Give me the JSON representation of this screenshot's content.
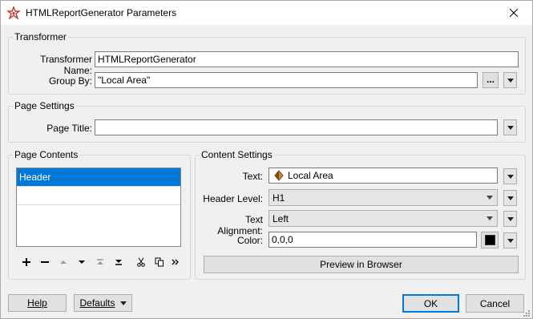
{
  "window": {
    "title": "HTMLReportGenerator Parameters"
  },
  "transformer": {
    "legend": "Transformer",
    "name_label": "Transformer Name:",
    "name_value": "HTMLReportGenerator",
    "group_label": "Group By:",
    "group_value": "\"Local Area\"",
    "ellipsis": "..."
  },
  "page_settings": {
    "legend": "Page Settings",
    "title_label": "Page Title:",
    "title_value": ""
  },
  "page_contents": {
    "legend": "Page Contents",
    "items": [
      "Header"
    ],
    "selected_index": 0,
    "toolbar_icons": [
      "add-icon",
      "remove-icon",
      "move-up-icon",
      "move-down-icon",
      "move-top-icon",
      "move-bottom-icon",
      "cut-icon",
      "copy-icon",
      "more-icon"
    ]
  },
  "content_settings": {
    "legend": "Content Settings",
    "text_label": "Text:",
    "text_value": "Local Area",
    "header_level_label": "Header Level:",
    "header_level_value": "H1",
    "alignment_label": "Text Alignment:",
    "alignment_value": "Left",
    "color_label": "Color:",
    "color_value": "0,0,0",
    "color_swatch": "#000000",
    "preview_label": "Preview in Browser"
  },
  "footer": {
    "help_label": "Help",
    "defaults_label": "Defaults",
    "ok_label": "OK",
    "cancel_label": "Cancel"
  },
  "colors": {
    "selection": "#0078d7",
    "default_button_border": "#0078d7"
  }
}
